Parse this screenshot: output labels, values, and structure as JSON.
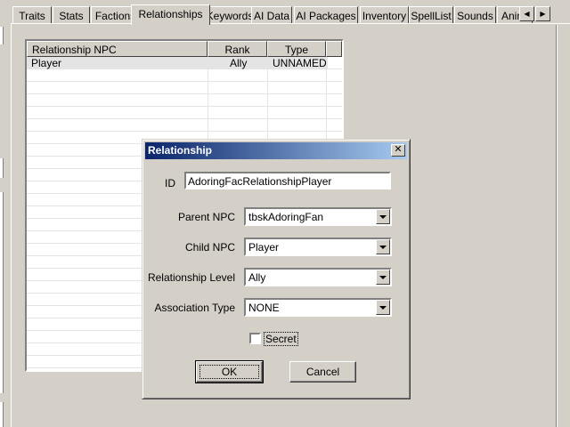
{
  "tabs": [
    {
      "label": "Traits"
    },
    {
      "label": "Stats"
    },
    {
      "label": "Factions"
    },
    {
      "label": "Relationships",
      "active": true
    },
    {
      "label": "Keywords"
    },
    {
      "label": "AI Data"
    },
    {
      "label": "AI Packages"
    },
    {
      "label": "Inventory"
    },
    {
      "label": "SpellList"
    },
    {
      "label": "Sounds"
    },
    {
      "label": "Anim"
    }
  ],
  "tab_scroll": {
    "left_icon": "◀",
    "right_icon": "▶"
  },
  "relationship_list": {
    "columns": [
      "Relationship NPC",
      "Rank",
      "Type"
    ],
    "rows": [
      {
        "npc": "Player",
        "rank": "Ally",
        "type": "UNNAMED"
      }
    ]
  },
  "dialog": {
    "title": "Relationship",
    "close_icon": "✕",
    "id_label": "ID",
    "id_value": "AdoringFacRelationshipPlayer",
    "parent_npc_label": "Parent NPC",
    "parent_npc_value": "tbskAdoringFan",
    "child_npc_label": "Child NPC",
    "child_npc_value": "Player",
    "relationship_level_label": "Relationship Level",
    "relationship_level_value": "Ally",
    "association_type_label": "Association Type",
    "association_type_value": "NONE",
    "secret_label": "Secret",
    "secret_checked": false,
    "ok_label": "OK",
    "cancel_label": "Cancel"
  },
  "colors": {
    "window_bg": "#d4d0c8",
    "title_gradient_start": "#0a246a",
    "title_gradient_end": "#a6caf0",
    "selected_row": "#e4e4e4"
  }
}
